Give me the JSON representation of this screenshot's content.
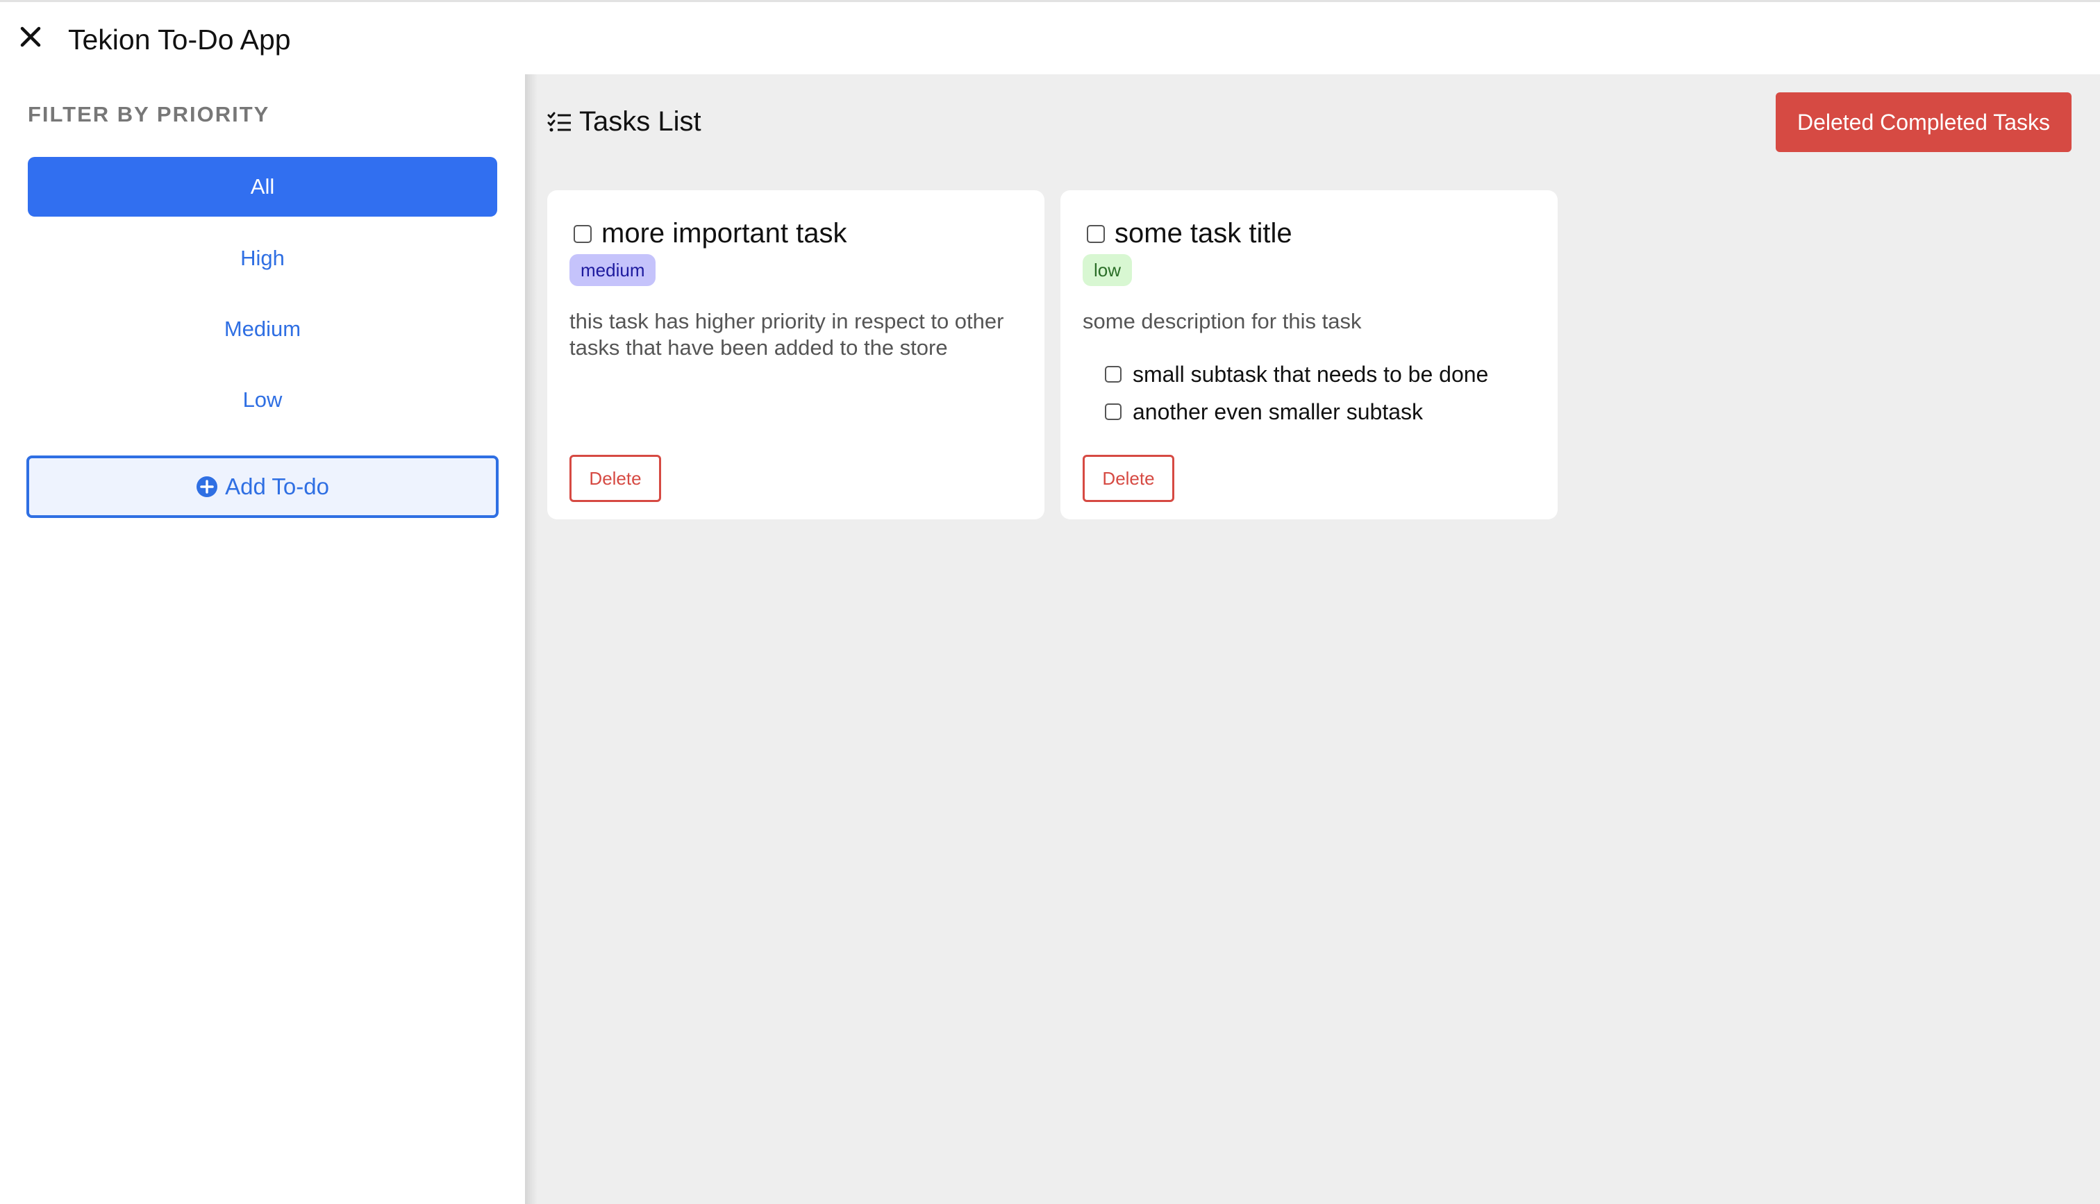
{
  "app": {
    "title": "Tekion To-Do App",
    "close_icon": "close-icon"
  },
  "sidebar": {
    "heading": "FILTER BY PRIORITY",
    "filters": [
      {
        "label": "All",
        "active": true
      },
      {
        "label": "High",
        "active": false
      },
      {
        "label": "Medium",
        "active": false
      },
      {
        "label": "Low",
        "active": false
      }
    ],
    "add_label": "Add To-do",
    "add_icon": "plus-circle-icon"
  },
  "main": {
    "heading": "Tasks List",
    "heading_icon": "checklist-icon",
    "delete_completed_label": "Deleted Completed Tasks",
    "tasks": [
      {
        "title": "more important task",
        "priority": "medium",
        "description": "this task has higher priority in respect to other tasks that have been added to the store",
        "subtasks": [],
        "delete_label": "Delete"
      },
      {
        "title": "some task title",
        "priority": "low",
        "description": "some description for this task",
        "subtasks": [
          {
            "label": "small subtask that needs to be done"
          },
          {
            "label": "another even smaller subtask"
          }
        ],
        "delete_label": "Delete"
      }
    ]
  },
  "colors": {
    "accent": "#316ff0",
    "danger": "#d64a43",
    "main_background": "#eeeeee",
    "medium_badge": "#c5c3fb",
    "low_badge": "#d8f7d2"
  }
}
